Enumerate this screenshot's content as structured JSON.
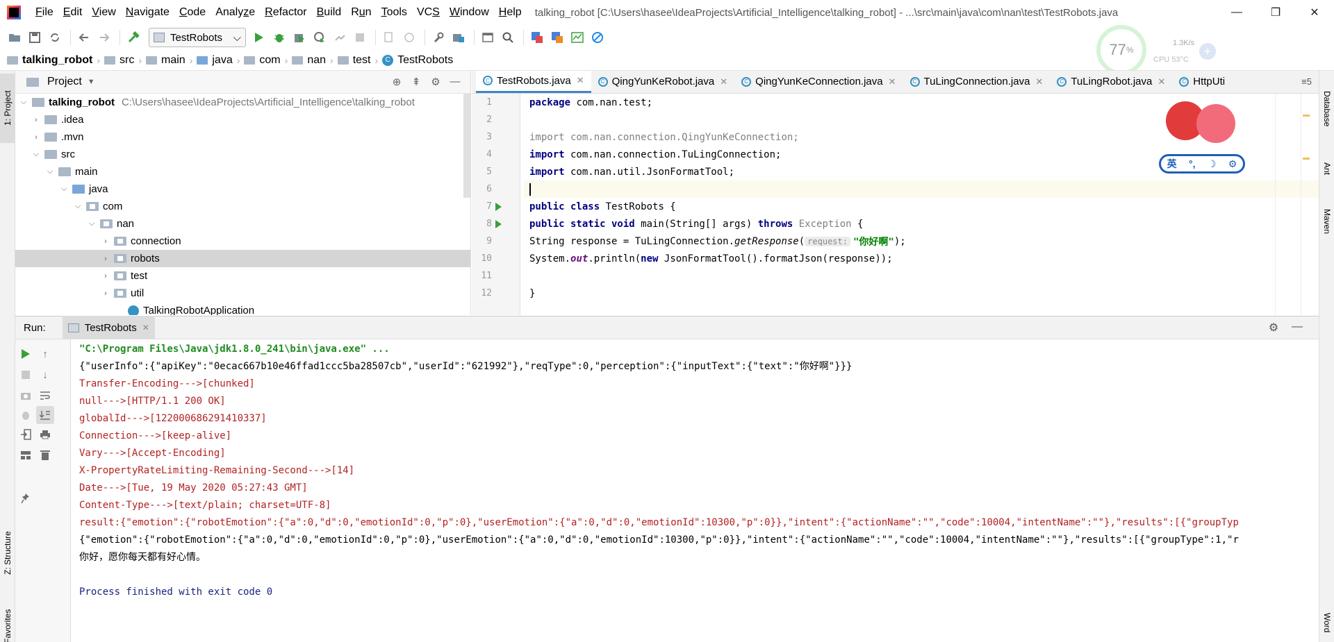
{
  "menubar": {
    "items": [
      {
        "label": "File",
        "mnemonic": "F"
      },
      {
        "label": "Edit",
        "mnemonic": "E"
      },
      {
        "label": "View",
        "mnemonic": "V"
      },
      {
        "label": "Navigate",
        "mnemonic": "N"
      },
      {
        "label": "Code",
        "mnemonic": "C"
      },
      {
        "label": "Analyze",
        "mnemonic": "z"
      },
      {
        "label": "Refactor",
        "mnemonic": "R"
      },
      {
        "label": "Build",
        "mnemonic": "B"
      },
      {
        "label": "Run",
        "mnemonic": "u"
      },
      {
        "label": "Tools",
        "mnemonic": "T"
      },
      {
        "label": "VCS",
        "mnemonic": "S"
      },
      {
        "label": "Window",
        "mnemonic": "W"
      },
      {
        "label": "Help",
        "mnemonic": "H"
      }
    ],
    "window_title": "talking_robot [C:\\Users\\hasee\\IdeaProjects\\Artificial_Intelligence\\talking_robot] - ...\\src\\main\\java\\com\\nan\\test\\TestRobots.java",
    "controls": {
      "minimize": "—",
      "restore": "❐",
      "close": "✕"
    }
  },
  "toolbar": {
    "run_config": "TestRobots"
  },
  "perf": {
    "percent": "77",
    "unit": "%",
    "speed": "1.3K/s",
    "cpu": "CPU 53°C",
    "plus": "+"
  },
  "breadcrumb": [
    "talking_robot",
    "src",
    "main",
    "java",
    "com",
    "nan",
    "test",
    "TestRobots"
  ],
  "left_strip": {
    "project": "1: Project",
    "structure": "Z: Structure",
    "favorites": "Favorites"
  },
  "right_strip": {
    "database": "Database",
    "ant": "Ant",
    "maven": "Maven",
    "word": "Word"
  },
  "project": {
    "title": "Project",
    "tree": [
      {
        "label": "talking_robot",
        "path": "C:\\Users\\hasee\\IdeaProjects\\Artificial_Intelligence\\talking_robot"
      },
      {
        "label": ".idea"
      },
      {
        "label": ".mvn"
      },
      {
        "label": "src"
      },
      {
        "label": "main"
      },
      {
        "label": "java"
      },
      {
        "label": "com"
      },
      {
        "label": "nan"
      },
      {
        "label": "connection"
      },
      {
        "label": "robots"
      },
      {
        "label": "test"
      },
      {
        "label": "util"
      },
      {
        "label": "TalkingRobotApplication"
      }
    ]
  },
  "editor": {
    "tabs": [
      "TestRobots.java",
      "QingYunKeRobot.java",
      "QingYunKeConnection.java",
      "TuLingConnection.java",
      "TuLingRobot.java",
      "HttpUti"
    ],
    "tab_overflow": "≡5",
    "line_numbers": [
      "1",
      "2",
      "3",
      "4",
      "5",
      "6",
      "7",
      "8",
      "9",
      "10",
      "11",
      "12"
    ],
    "code": {
      "l1_kw": "package",
      "l1_rest": " com.nan.test;",
      "l3_kw": "import",
      "l3_rest": " com.nan.connection.QingYunKeConnection;",
      "l4_kw": "import",
      "l4_rest": " com.nan.connection.TuLingConnection;",
      "l5_kw": "import",
      "l5_rest": " com.nan.util.JsonFormatTool;",
      "l7_kw": "public class",
      "l7_rest": " TestRobots {",
      "l8_kw1": "public static void",
      "l8_mid": " main(String[] args) ",
      "l8_kw2": "throws",
      "l8_exc": " Exception",
      "l8_end": " {",
      "l9_a": "String response = TuLingConnection.",
      "l9_method": "getResponse",
      "l9_paren": "(",
      "l9_hint": "request:",
      "l9_str": "\"你好啊\"",
      "l9_end": ");",
      "l10_a": "System.",
      "l10_out": "out",
      "l10_b": ".println(",
      "l10_new": "new",
      "l10_c": " JsonFormatTool().formatJson(response));",
      "l12": "}"
    }
  },
  "mascot": {
    "chars": [
      "英",
      "°,",
      "☽",
      "⚙"
    ]
  },
  "run": {
    "label": "Run:",
    "tab": "TestRobots",
    "console": [
      {
        "kind": "cmd",
        "text": "\"C:\\Program Files\\Java\\jdk1.8.0_241\\bin\\java.exe\" ..."
      },
      {
        "kind": "out",
        "text": "{\"userInfo\":{\"apiKey\":\"0ecac667b10e46ffad1ccc5ba28507cb\",\"userId\":\"621992\"},\"reqType\":0,\"perception\":{\"inputText\":{\"text\":\"你好啊\"}}}"
      },
      {
        "kind": "err",
        "text": "Transfer-Encoding--->[chunked]"
      },
      {
        "kind": "err",
        "text": "null--->[HTTP/1.1 200 OK]"
      },
      {
        "kind": "err",
        "text": "globalId--->[122000686291410337]"
      },
      {
        "kind": "err",
        "text": "Connection--->[keep-alive]"
      },
      {
        "kind": "err",
        "text": "Vary--->[Accept-Encoding]"
      },
      {
        "kind": "err",
        "text": "X-PropertyRateLimiting-Remaining-Second--->[14]"
      },
      {
        "kind": "err",
        "text": "Date--->[Tue, 19 May 2020 05:27:43 GMT]"
      },
      {
        "kind": "err",
        "text": "Content-Type--->[text/plain; charset=UTF-8]"
      },
      {
        "kind": "err",
        "text": "result:{\"emotion\":{\"robotEmotion\":{\"a\":0,\"d\":0,\"emotionId\":0,\"p\":0},\"userEmotion\":{\"a\":0,\"d\":0,\"emotionId\":10300,\"p\":0}},\"intent\":{\"actionName\":\"\",\"code\":10004,\"intentName\":\"\"},\"results\":[{\"groupTyp"
      },
      {
        "kind": "out",
        "text": "{\"emotion\":{\"robotEmotion\":{\"a\":0,\"d\":0,\"emotionId\":0,\"p\":0},\"userEmotion\":{\"a\":0,\"d\":0,\"emotionId\":10300,\"p\":0}},\"intent\":{\"actionName\":\"\",\"code\":10004,\"intentName\":\"\"},\"results\":[{\"groupType\":1,\"r"
      },
      {
        "kind": "out-cn",
        "text": "你好，愿你每天都有好心情。"
      },
      {
        "kind": "blank",
        "text": ""
      },
      {
        "kind": "exit",
        "text": "Process finished with exit code 0"
      }
    ]
  }
}
